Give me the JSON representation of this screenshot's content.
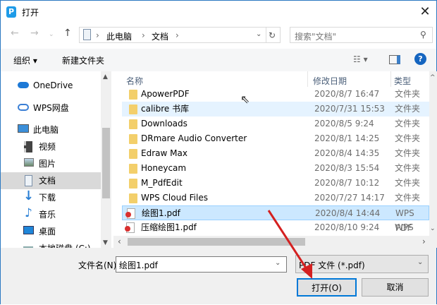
{
  "window": {
    "title": "打开",
    "app_icon": "P"
  },
  "nav": {
    "breadcrumb": [
      "此电脑",
      "文档"
    ],
    "search_placeholder": "搜索\"文档\""
  },
  "toolbar": {
    "organize": "组织",
    "new_folder": "新建文件夹",
    "help": "?"
  },
  "sidebar": {
    "items": [
      {
        "label": "OneDrive",
        "icon": "cloud-icon"
      },
      {
        "label": "WPS网盘",
        "icon": "wps-cloud-icon"
      },
      {
        "label": "此电脑",
        "icon": "computer-icon"
      },
      {
        "label": "视频",
        "icon": "video-icon"
      },
      {
        "label": "图片",
        "icon": "picture-icon"
      },
      {
        "label": "文档",
        "icon": "document-icon",
        "selected": true
      },
      {
        "label": "下载",
        "icon": "download-icon"
      },
      {
        "label": "音乐",
        "icon": "music-icon"
      },
      {
        "label": "桌面",
        "icon": "desktop-icon"
      },
      {
        "label": "本地磁盘 (C:)",
        "icon": "drive-icon"
      }
    ]
  },
  "list": {
    "columns": [
      "名称",
      "修改日期",
      "类型"
    ],
    "rows": [
      {
        "name": "ApowerPDF",
        "date": "2020/8/7 16:47",
        "type": "文件夹",
        "kind": "folder"
      },
      {
        "name": "calibre 书库",
        "date": "2020/7/31 15:53",
        "type": "文件夹",
        "kind": "folder",
        "hover": true
      },
      {
        "name": "Downloads",
        "date": "2020/8/5 9:24",
        "type": "文件夹",
        "kind": "folder"
      },
      {
        "name": "DRmare Audio Converter",
        "date": "2020/8/1 14:25",
        "type": "文件夹",
        "kind": "folder"
      },
      {
        "name": "Edraw Max",
        "date": "2020/8/4 14:35",
        "type": "文件夹",
        "kind": "folder"
      },
      {
        "name": "Honeycam",
        "date": "2020/8/3 15:54",
        "type": "文件夹",
        "kind": "folder"
      },
      {
        "name": "M_PdfEdit",
        "date": "2020/8/7 10:12",
        "type": "文件夹",
        "kind": "folder"
      },
      {
        "name": "WPS Cloud Files",
        "date": "2020/7/27 14:17",
        "type": "文件夹",
        "kind": "folder"
      },
      {
        "name": "绘图1.pdf",
        "date": "2020/8/4 14:44",
        "type": "WPS PDF",
        "kind": "pdf",
        "selected": true
      },
      {
        "name": "压缩绘图1.pdf",
        "date": "2020/8/10 9:24",
        "type": "WPS PDF",
        "kind": "pdf"
      }
    ]
  },
  "footer": {
    "filename_label": "文件名(N):",
    "filename_value": "绘图1.pdf",
    "filter": "PDF 文件 (*.pdf)",
    "open": "打开(O)",
    "cancel": "取消"
  },
  "colors": {
    "accent": "#0078d7",
    "selected": "#cce8ff",
    "hover": "#e5f3ff",
    "arrow": "#d42020"
  }
}
